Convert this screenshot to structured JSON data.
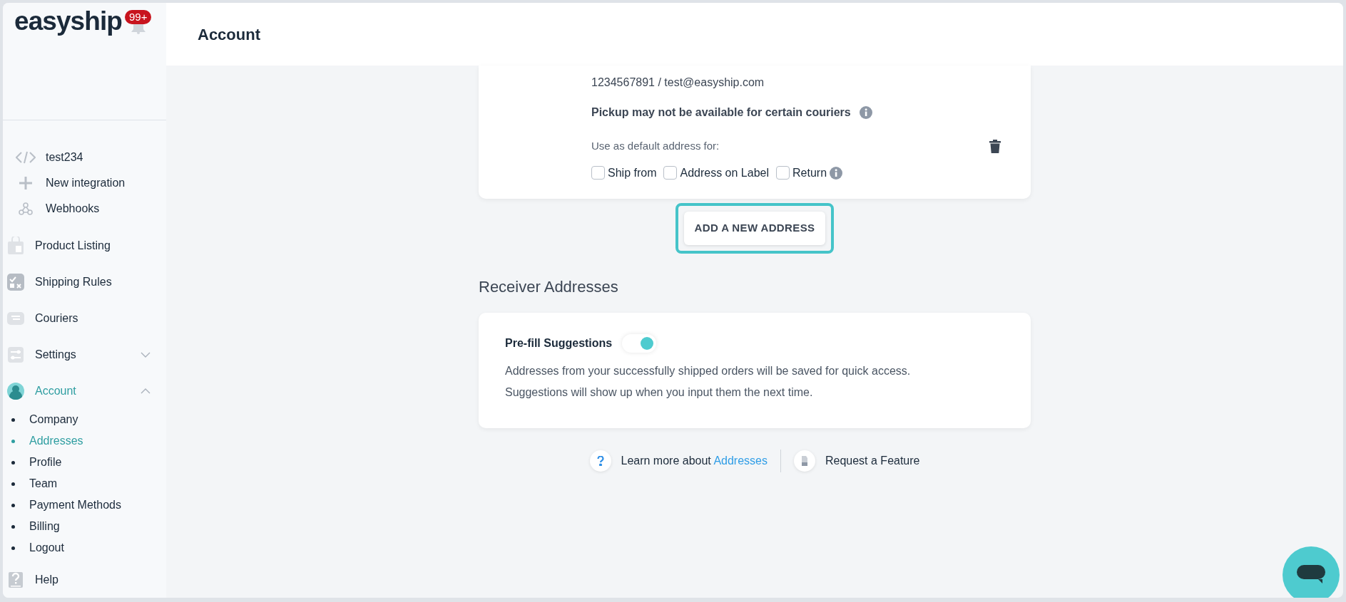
{
  "logo": "easyship",
  "notifications": {
    "badge": "99+"
  },
  "sidebar": {
    "integrations": [
      {
        "label": "test234"
      },
      {
        "label": "New integration"
      },
      {
        "label": "Webhooks"
      }
    ],
    "items": [
      {
        "label": "Product Listing",
        "kind": "link",
        "selected": false
      },
      {
        "label": "Shipping Rules",
        "kind": "link",
        "selected": false
      },
      {
        "label": "Couriers",
        "kind": "link",
        "selected": false
      },
      {
        "label": "Settings",
        "kind": "group",
        "expanded": false,
        "selected": false
      },
      {
        "label": "Account",
        "kind": "group",
        "expanded": true,
        "selected": true,
        "children": [
          {
            "label": "Company",
            "selected": false
          },
          {
            "label": "Addresses",
            "selected": true
          },
          {
            "label": "Profile",
            "selected": false
          },
          {
            "label": "Team",
            "selected": false
          },
          {
            "label": "Payment Methods",
            "selected": false
          },
          {
            "label": "Billing",
            "selected": false
          },
          {
            "label": "Logout",
            "selected": false
          }
        ]
      },
      {
        "label": "Help",
        "kind": "link",
        "selected": false
      }
    ]
  },
  "header": {
    "title": "Account"
  },
  "sender_card": {
    "contact": "1234567891 / test@easyship.com",
    "pickup_note": "Pickup may not be available for certain couriers",
    "default_label": "Use as default address for:",
    "defaults": [
      {
        "label": "Ship from",
        "checked": false
      },
      {
        "label": "Address on Label",
        "checked": false
      },
      {
        "label": "Return",
        "checked": false
      }
    ]
  },
  "add_button": {
    "label": "ADD A NEW ADDRESS",
    "focused": true
  },
  "receiver": {
    "title": "Receiver Addresses",
    "prefill_label": "Pre-fill Suggestions",
    "on": true,
    "description": [
      "Addresses from your successfully shipped orders will be saved for quick access.",
      "Suggestions will show up when you input them the next time."
    ]
  },
  "footer": {
    "learn_text": "Learn more about",
    "learn_link": "Addresses",
    "request": "Request a Feature"
  }
}
